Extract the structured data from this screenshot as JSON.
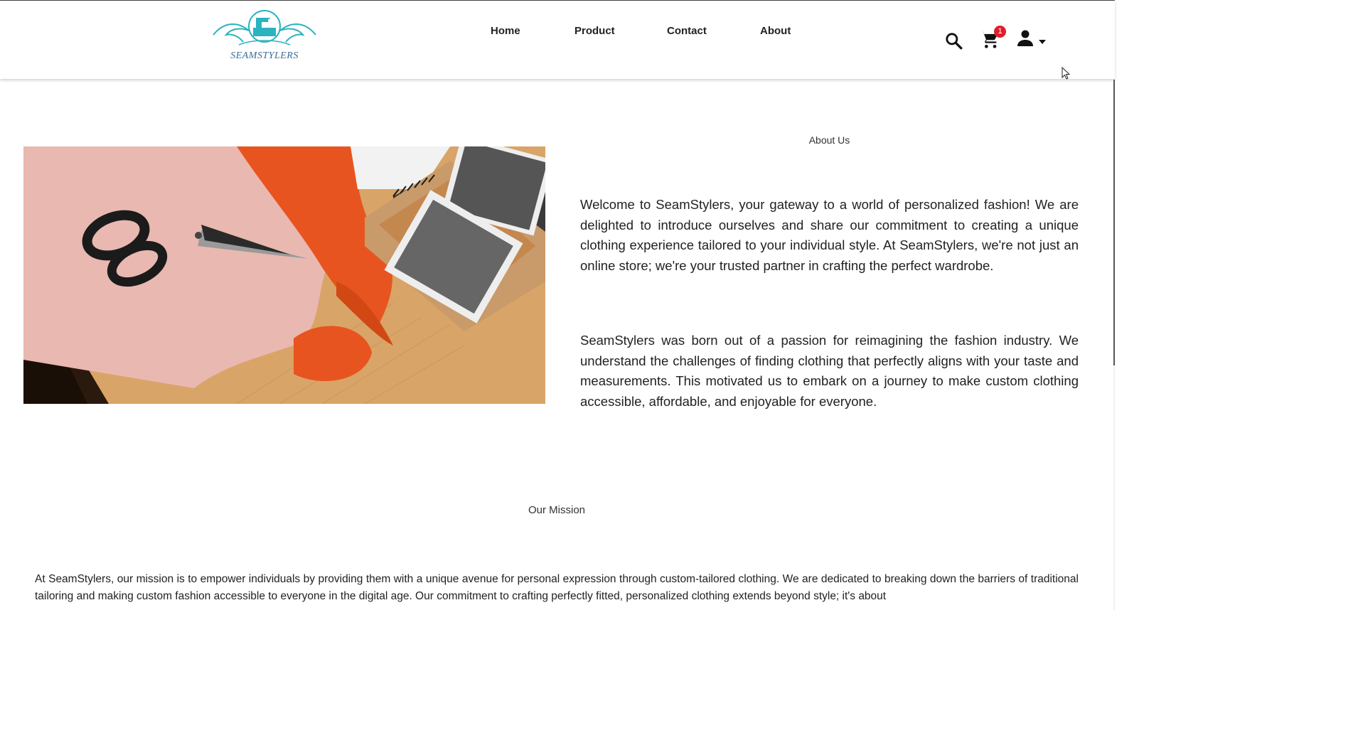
{
  "brand": {
    "name": "SEAMSTYLERS",
    "accent": "#2bb3c0"
  },
  "nav": {
    "items": [
      {
        "label": "Home"
      },
      {
        "label": "Product"
      },
      {
        "label": "Contact"
      },
      {
        "label": "About"
      }
    ]
  },
  "header_icons": {
    "search": "search-icon",
    "cart": "cart-icon",
    "cart_count": "1",
    "user": "user-icon",
    "dropdown": "caret-down-icon"
  },
  "about": {
    "title": "About Us",
    "paragraphs": [
      "Welcome to SeamStylers, your gateway to a world of personalized fashion! We are delighted to introduce ourselves and share our commitment to creating a unique clothing experience tailored to your individual style. At SeamStylers, we're not just an online store; we're your trusted partner in crafting the perfect wardrobe.",
      "SeamStylers was born out of a passion for reimagining the fashion industry. We understand the challenges of finding clothing that perfectly aligns with your taste and measurements. This motivated us to embark on a journey to make custom clothing accessible, affordable, and enjoyable for everyone."
    ]
  },
  "mission": {
    "title": "Our Mission",
    "text": "At SeamStylers, our mission is to empower individuals by providing them with a unique avenue for personal expression through custom-tailored clothing. We are dedicated to breaking down the barriers of traditional tailoring and making custom fashion accessible to everyone in the digital age. Our commitment to crafting perfectly fitted, personalized clothing extends beyond style; it's about"
  },
  "colors": {
    "badge": "#e11d2a",
    "fabric_orange": "#e8541f",
    "pattern_paper": "#e9b8b0",
    "wood": "#d9a467"
  }
}
